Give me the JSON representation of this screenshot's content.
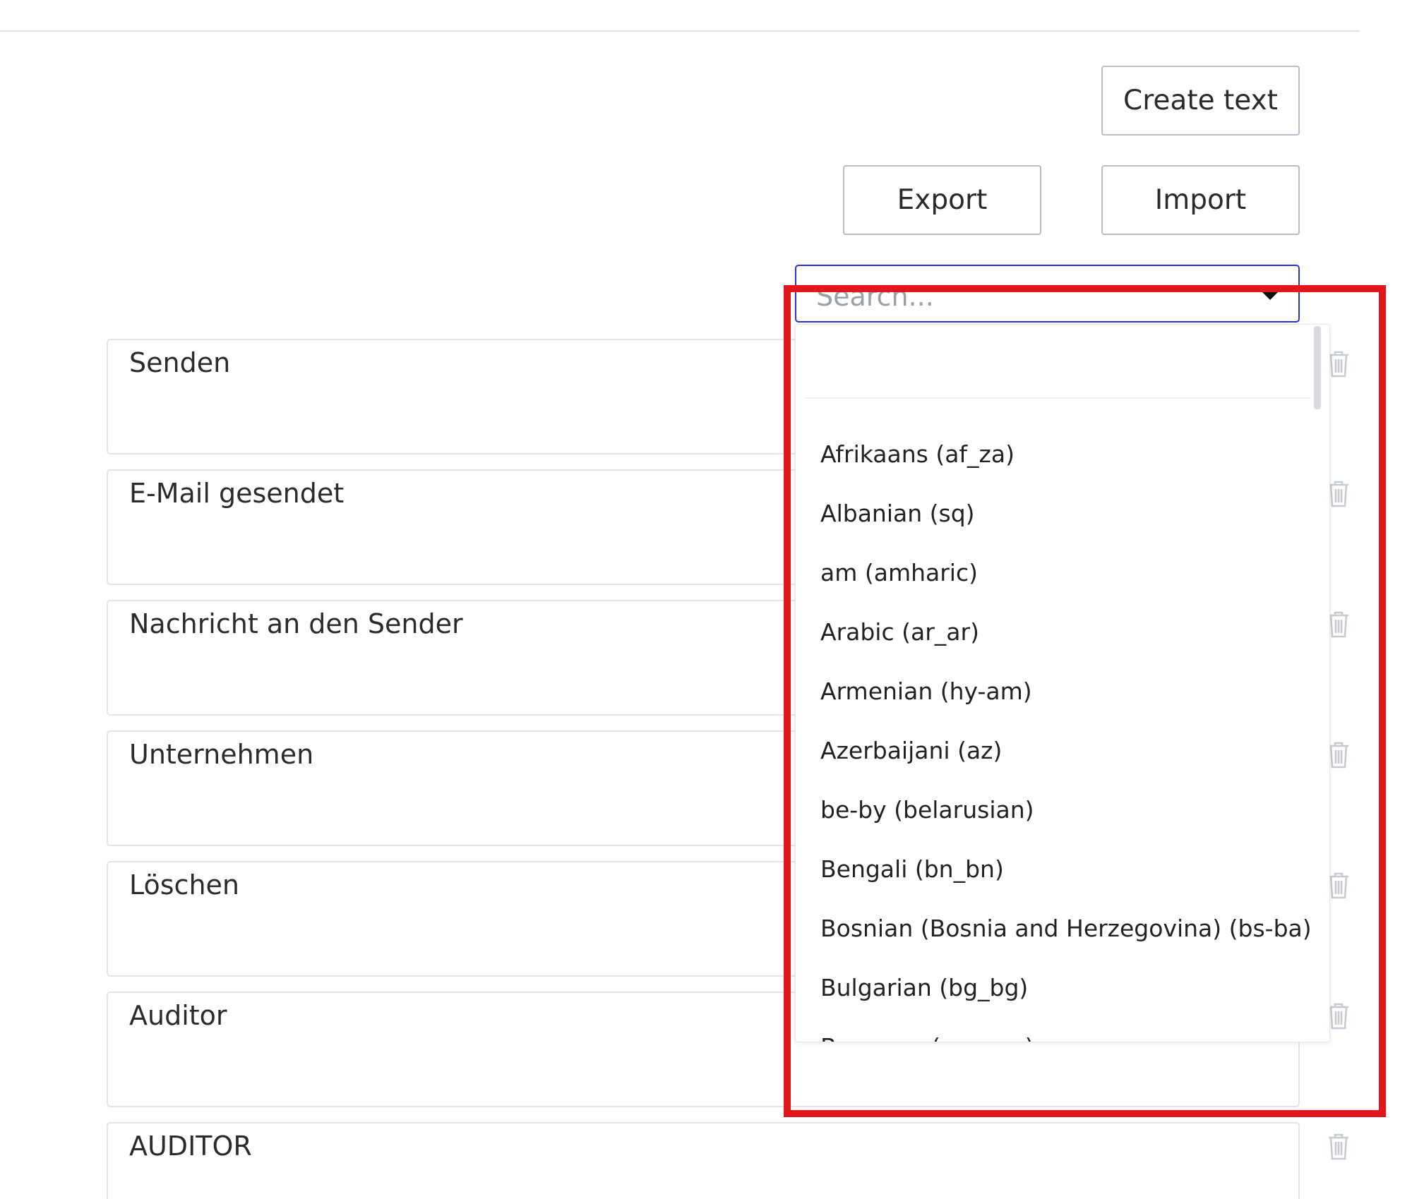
{
  "toolbar": {
    "create_text_label": "Create text",
    "export_label": "Export",
    "import_label": "Import"
  },
  "language_select": {
    "placeholder": "Search...",
    "options": [
      "Afrikaans (af_za)",
      "Albanian (sq)",
      "am (amharic)",
      "Arabic (ar_ar)",
      "Armenian (hy-am)",
      "Azerbaijani (az)",
      "be-by (belarusian)",
      "Bengali (bn_bn)",
      "Bosnian (Bosnia and Herzegovina) (bs-ba)",
      "Bulgarian (bg_bg)",
      "Burmese (my_my)"
    ]
  },
  "texts": [
    "Senden",
    "E-Mail gesendet",
    "Nachricht an den Sender",
    "Unternehmen",
    "Löschen",
    "Auditor",
    "AUDITOR"
  ],
  "icons": {
    "delete": "trash-icon",
    "select_caret": "caret-down-icon"
  },
  "colors": {
    "select_focus_border": "#2b33c9",
    "highlight_outline": "#e3161c",
    "trash_icon": "#c7cad0"
  }
}
